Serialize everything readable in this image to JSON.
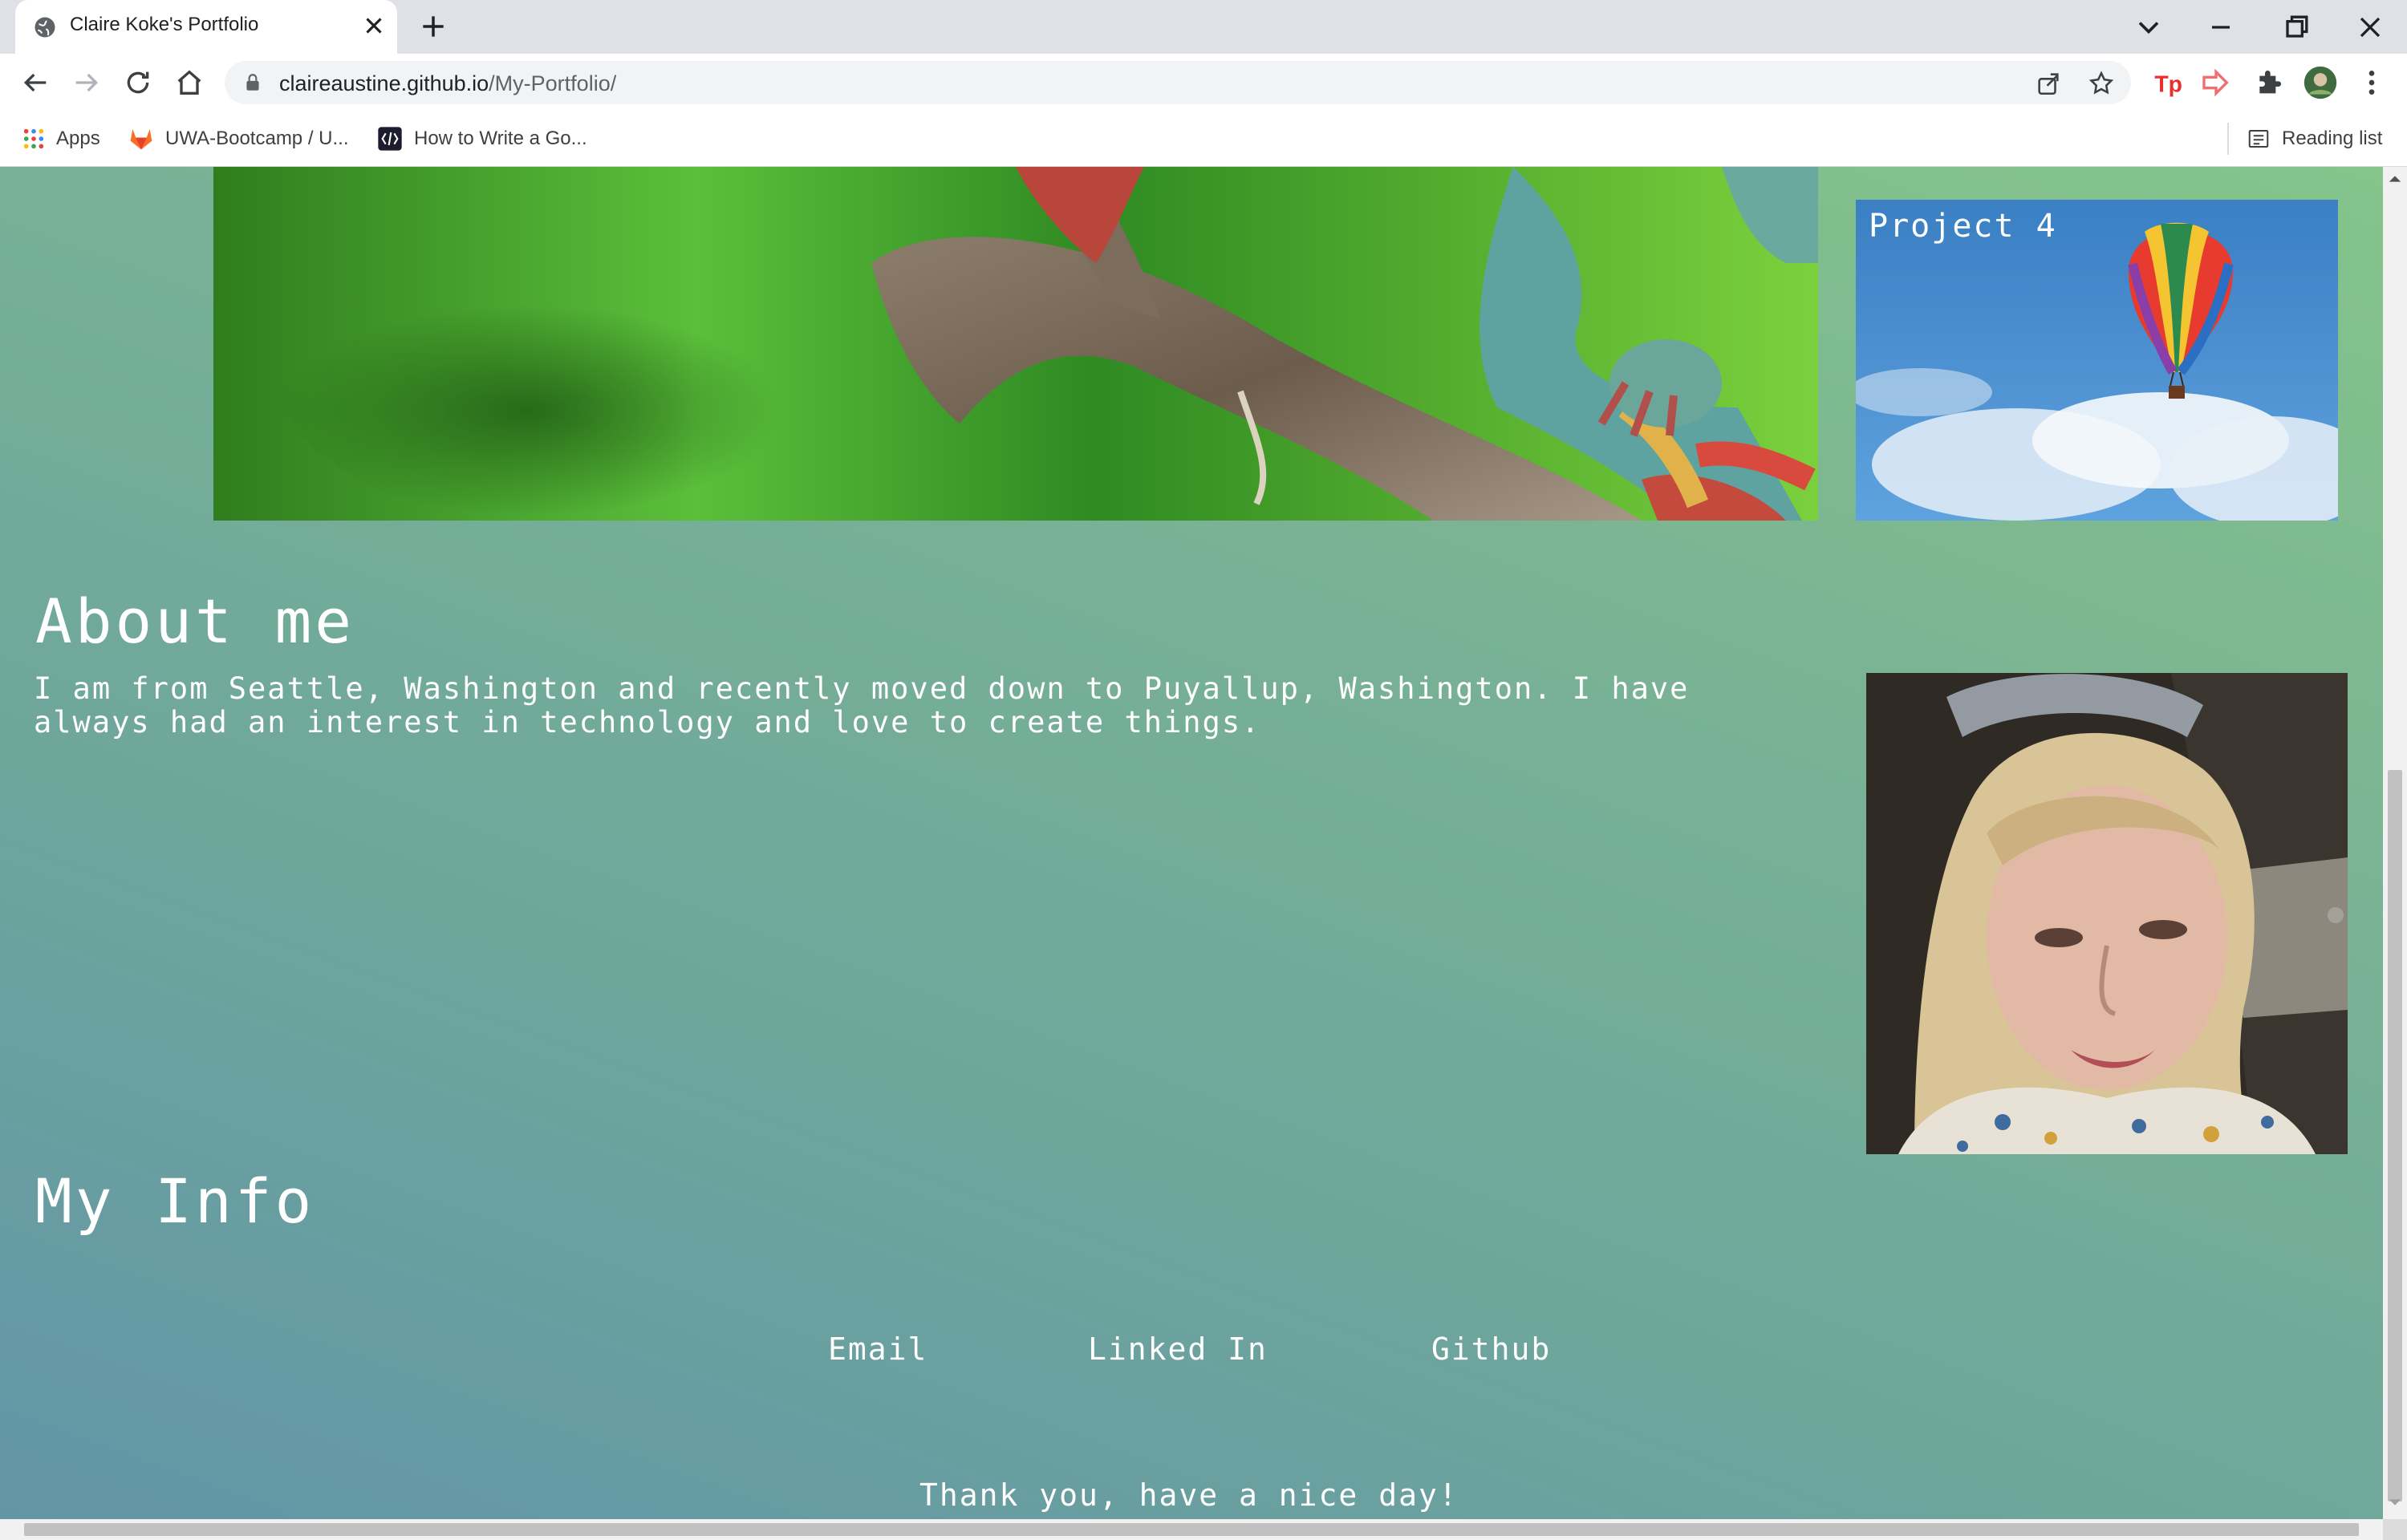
{
  "browser": {
    "tab_title": "Claire Koke's Portfolio",
    "url_host": "claireaustine.github.io",
    "url_path": "/My-Portfolio/",
    "bookmarks": [
      {
        "label": "Apps",
        "icon": "apps-grid-icon"
      },
      {
        "label": "UWA-Bootcamp / U...",
        "icon": "gitlab-icon"
      },
      {
        "label": "How to Write a Go...",
        "icon": "dev-logo-icon"
      }
    ],
    "reading_list": "Reading list",
    "extensions": [
      "tp-extension-icon",
      "share-arrow-extension-icon",
      "puzzle-extensions-icon",
      "profile-avatar"
    ]
  },
  "page": {
    "project_card_label": "Project 4",
    "about_heading": "About me",
    "about_text": "I am from Seattle, Washington and recently moved down to Puyallup, Washington. I have always had an interest in technology and love to create things.",
    "info_heading": "My Info",
    "links": [
      "Email",
      "Linked In",
      "Github"
    ],
    "footer_text": "Thank you, have a nice day!"
  },
  "colors": {
    "gradient_start": "#6395a7",
    "gradient_end": "#85c48b",
    "text": "#ffffff"
  }
}
